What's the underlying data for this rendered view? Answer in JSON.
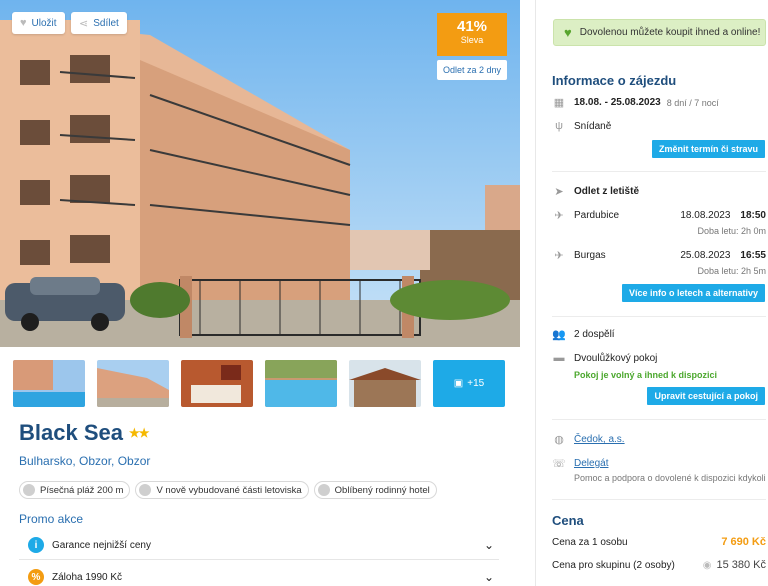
{
  "hero": {
    "save_label": "Uložit",
    "share_label": "Sdílet",
    "discount_pct": "41%",
    "discount_label": "Sleva",
    "departure_chip": "Odlet za 2 dny"
  },
  "thumbnails": {
    "more_label": "+15"
  },
  "hotel": {
    "name": "Black Sea",
    "stars": "★★",
    "star_count": 2,
    "location": "Bulharsko, Obzor, Obzor",
    "tags": [
      "Písečná pláž 200 m",
      "V nově vybudované části letoviska",
      "Oblíbený rodinný hotel"
    ]
  },
  "promo": {
    "title": "Promo akce",
    "items": [
      {
        "label": "Garance nejnižší ceny",
        "icon": "info-icon",
        "color": "#1eaae7"
      },
      {
        "label": "Záloha 1990 Kč",
        "icon": "percent-icon",
        "color": "#f39c12"
      }
    ]
  },
  "sidebar": {
    "banner": "Dovolenou můžete koupit ihned a online!",
    "info_title": "Informace o zájezdu",
    "dates": "18.08. - 25.08.2023",
    "duration": "8 dní / 7 nocí",
    "board": "Snídaně",
    "change_button": "Změnit termín či stravu",
    "departure_title": "Odlet z letiště",
    "flights": [
      {
        "city": "Pardubice",
        "date": "18.08.2023",
        "time": "18:50",
        "duration": "Doba letu: 2h 0m"
      },
      {
        "city": "Burgas",
        "date": "25.08.2023",
        "time": "16:55",
        "duration": "Doba letu: 2h 5m"
      }
    ],
    "flights_button": "Více info o letech a alternativy",
    "travelers": "2 dospělí",
    "room": "Dvoulůžkový pokoj",
    "room_status": "Pokoj je volný a ihned k dispozici",
    "edit_button": "Upravit cestující a pokoj",
    "agency": "Čedok, a.s.",
    "delegate": "Delegát",
    "delegate_note": "Pomoc a podpora o dovolené k dispozici kdykoli",
    "price_title": "Cena",
    "price_per_person_label": "Cena za 1 osobu",
    "price_per_person": "7 690 Kč",
    "price_group_label": "Cena pro skupinu (2 osoby)",
    "price_group": "15 380 Kč"
  },
  "colors": {
    "accent_blue": "#1eaae7",
    "title_blue": "#1f4e7d",
    "orange": "#f39c12",
    "green": "#4ca82e"
  }
}
